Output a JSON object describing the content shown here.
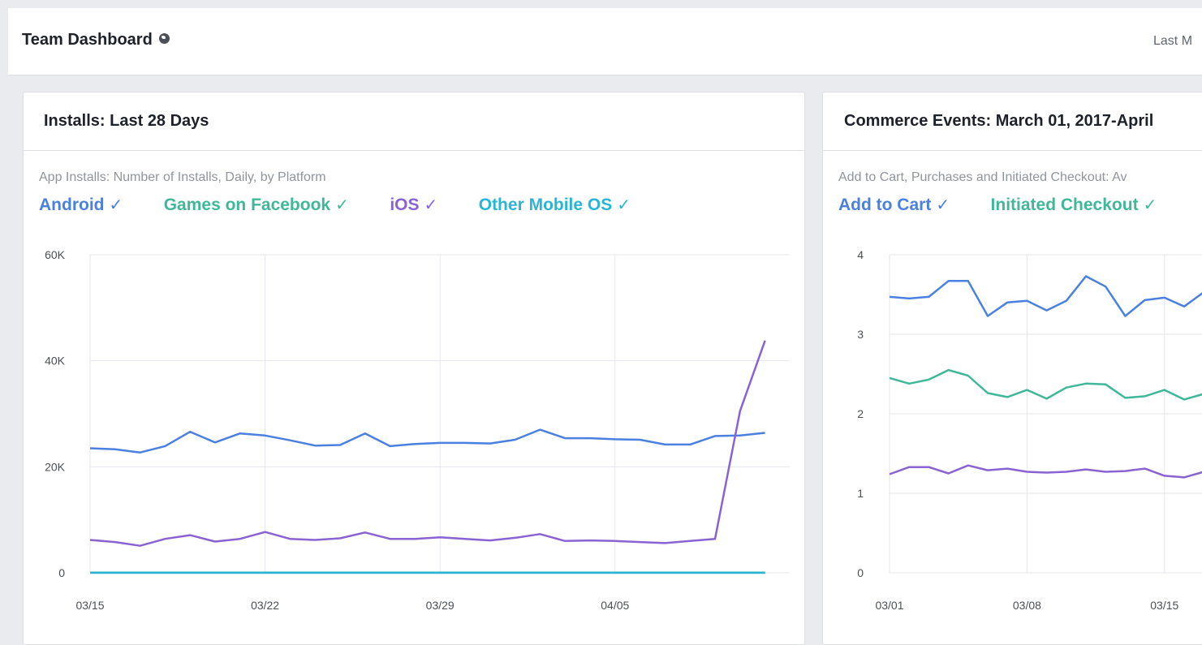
{
  "header": {
    "title": "Team Dashboard",
    "range_label": "Last M"
  },
  "panels": [
    {
      "title": "Installs: Last 28 Days",
      "subtitle": "App Installs: Number of Installs, Daily, by Platform",
      "legend": [
        {
          "label": "Android",
          "check": "✓",
          "color": "#4a80e0"
        },
        {
          "label": "Games on Facebook",
          "check": "✓",
          "color": "#3fb89a"
        },
        {
          "label": "iOS",
          "check": "✓",
          "color": "#8a63d2"
        },
        {
          "label": "Other Mobile OS",
          "check": "✓",
          "color": "#29b6d6"
        }
      ]
    },
    {
      "title": "Commerce Events: March 01, 2017-April",
      "subtitle": "Add to Cart, Purchases and Initiated Checkout: Av",
      "legend": [
        {
          "label": "Add to Cart",
          "check": "✓",
          "color": "#4a80e0"
        },
        {
          "label": "Initiated Checkout",
          "check": "✓",
          "color": "#3fb89a"
        }
      ]
    }
  ],
  "chart_data": [
    {
      "type": "line",
      "title": "Installs: Last 28 Days",
      "ylim": [
        0,
        60000
      ],
      "yticks": [
        0,
        20000,
        40000,
        60000
      ],
      "ytick_labels": [
        "0",
        "20K",
        "40K",
        "60K"
      ],
      "xticks": [
        "03/15",
        "03/22",
        "03/29",
        "04/05"
      ],
      "grid": true,
      "series": [
        {
          "name": "Android",
          "color": "#4a80e0",
          "values": [
            23500,
            23300,
            22700,
            23900,
            26600,
            24600,
            26300,
            25900,
            25000,
            24000,
            24100,
            26300,
            23900,
            24300,
            24500,
            24500,
            24400,
            25100,
            27000,
            25400,
            25400,
            25200,
            25100,
            24200,
            24200,
            25800,
            25900,
            26400
          ]
        },
        {
          "name": "Games on Facebook",
          "color": "#3fb89a",
          "values": [
            50,
            50,
            50,
            50,
            50,
            50,
            50,
            50,
            50,
            50,
            50,
            50,
            50,
            50,
            50,
            50,
            50,
            50,
            50,
            50,
            50,
            50,
            50,
            50,
            50,
            50,
            50,
            50
          ]
        },
        {
          "name": "iOS",
          "color": "#8a63d2",
          "values": [
            6200,
            5800,
            5100,
            6400,
            7100,
            5900,
            6400,
            7700,
            6400,
            6200,
            6500,
            7600,
            6400,
            6400,
            6700,
            6400,
            6100,
            6600,
            7300,
            6000,
            6100,
            6000,
            5800,
            5600,
            6000,
            6400,
            30500,
            43800
          ]
        },
        {
          "name": "Other Mobile OS",
          "color": "#29b6d6",
          "values": [
            0,
            0,
            0,
            0,
            0,
            0,
            0,
            0,
            0,
            0,
            0,
            0,
            0,
            0,
            0,
            0,
            0,
            0,
            0,
            0,
            0,
            0,
            0,
            0,
            0,
            0,
            0,
            0
          ]
        }
      ]
    },
    {
      "type": "line",
      "title": "Commerce Events: March 01, 2017-April",
      "ylim": [
        0,
        4
      ],
      "yticks": [
        0,
        1,
        2,
        3,
        4
      ],
      "ytick_labels": [
        "0",
        "1",
        "2",
        "3",
        "4"
      ],
      "xticks": [
        "03/01",
        "03/08",
        "03/15"
      ],
      "grid": true,
      "series": [
        {
          "name": "Add to Cart",
          "color": "#4a80e0",
          "values": [
            3.47,
            3.45,
            3.47,
            3.67,
            3.67,
            3.23,
            3.4,
            3.42,
            3.3,
            3.42,
            3.73,
            3.6,
            3.23,
            3.43,
            3.46,
            3.35,
            3.53
          ]
        },
        {
          "name": "Initiated Checkout",
          "color": "#3fb89a",
          "values": [
            2.45,
            2.38,
            2.43,
            2.55,
            2.48,
            2.26,
            2.21,
            2.3,
            2.19,
            2.33,
            2.38,
            2.37,
            2.2,
            2.22,
            2.3,
            2.18,
            2.25
          ]
        },
        {
          "name": "",
          "color": "#8a63d2",
          "values": [
            1.24,
            1.33,
            1.33,
            1.25,
            1.35,
            1.29,
            1.31,
            1.27,
            1.26,
            1.27,
            1.3,
            1.27,
            1.28,
            1.31,
            1.22,
            1.2,
            1.27
          ]
        }
      ]
    }
  ]
}
